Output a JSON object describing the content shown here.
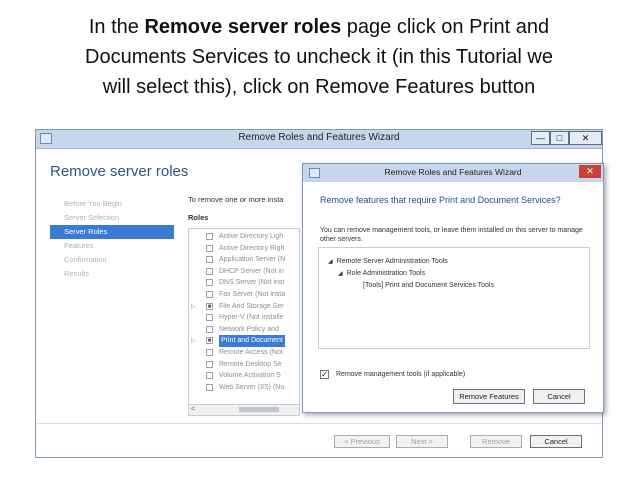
{
  "caption": {
    "line1_pre": "In the ",
    "line1_bold": "Remove server roles",
    "line1_post": " page click on Print and",
    "line2": "Documents Services  to uncheck it (in this Tutorial we",
    "line3": "will select this), click on Remove Features button"
  },
  "wizard": {
    "title": "Remove Roles and Features Wizard",
    "controls": {
      "minimize": "—",
      "maximize": "□",
      "close": "✕"
    },
    "page_title": "Remove server roles",
    "nav": [
      "Before You Begin",
      "Server Selection",
      "Server Roles",
      "Features",
      "Confirmation",
      "Results"
    ],
    "instruction": "To remove one or more insta",
    "roles_label": "Roles",
    "roles": [
      {
        "expander": "",
        "checked": "",
        "label": "Active Directory Ligh"
      },
      {
        "expander": "",
        "checked": "",
        "label": "Active Directory Righ"
      },
      {
        "expander": "",
        "checked": "",
        "label": "Application Server (N"
      },
      {
        "expander": "",
        "checked": "",
        "label": "DHCP Server (Not in"
      },
      {
        "expander": "",
        "checked": "",
        "label": "DNS Server (Not inst"
      },
      {
        "expander": "",
        "checked": "",
        "label": "Fax Server (Not insta"
      },
      {
        "expander": "▷",
        "checked": "■",
        "label": "File And Storage Ser"
      },
      {
        "expander": "",
        "checked": "",
        "label": "Hyper-V (Not installe"
      },
      {
        "expander": "",
        "checked": "",
        "label": "Network Policy and"
      },
      {
        "expander": "▷",
        "checked": "■",
        "label": "Print and Document"
      },
      {
        "expander": "",
        "checked": "",
        "label": "Remote Access (Not"
      },
      {
        "expander": "",
        "checked": "",
        "label": "Remote Desktop Se"
      },
      {
        "expander": "",
        "checked": "",
        "label": "Volume Activation S"
      },
      {
        "expander": "",
        "checked": "",
        "label": "Web Server (IIS) (No"
      }
    ],
    "scroll_left": "<",
    "buttons": {
      "previous": "< Previous",
      "next": "Next >",
      "remove": "Remove",
      "cancel": "Cancel"
    }
  },
  "dialog": {
    "title": "Remove Roles and Features Wizard",
    "close": "✕",
    "heading": "Remove features that require Print and Document Services?",
    "description": "You can remove management tools, or leave them installed on this server to manage other servers.",
    "tree": [
      {
        "arrow": "◢",
        "label": "Remote Server Administration Tools"
      },
      {
        "arrow": "◢",
        "label": "Role Administration Tools"
      },
      {
        "arrow": "",
        "label": "[Tools] Print and Document Services Tools"
      }
    ],
    "checkbox_mark": "✓",
    "checkbox_label": "Remove management tools (if applicable)",
    "buttons": {
      "remove_features": "Remove Features",
      "cancel": "Cancel"
    }
  },
  "colors": {
    "accent": "#3a7bd5",
    "titlebar": "#c7d7ea",
    "heading": "#1f4e8c",
    "close": "#c9413a"
  }
}
